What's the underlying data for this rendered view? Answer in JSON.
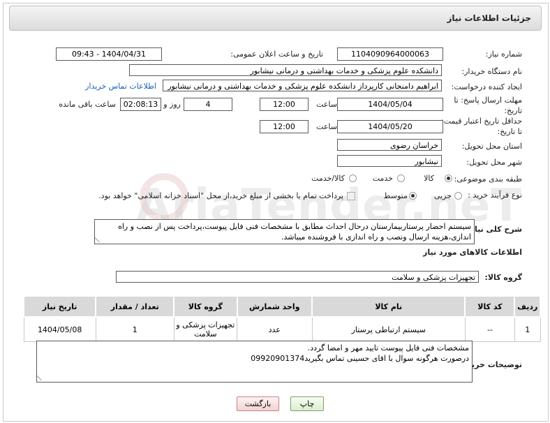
{
  "header": {
    "title": "جزئیات اطلاعات نیاز"
  },
  "form": {
    "need_number_label": "شماره نیاز:",
    "need_number": "1104090964000063",
    "announce_label": "تاریخ و ساعت اعلان عمومی:",
    "announce_value": "1404/04/31 - 09:43",
    "buyer_org_label": "نام دستگاه خریدار:",
    "buyer_org": "دانشکده علوم پزشکی و خدمات بهداشتی و درمانی نیشابور",
    "creator_label": "ایجاد کننده درخواست:",
    "creator": "ابراهیم دامنجانی  کارپرداز دانشکده علوم پزشکی و خدمات بهداشتی و درمانی نیشابور",
    "contact_link": "اطلاعات تماس خریدار",
    "deadline_label": "مهلت ارسال پاسخ: تا تاریخ:",
    "deadline_date": "1404/05/04",
    "time_label": "ساعت",
    "deadline_time": "12:00",
    "days_value": "4",
    "days_label": "روز و",
    "remaining_time": "02:08:13",
    "remaining_label": "ساعت باقی مانده",
    "price_valid_label": "حداقل تاریخ اعتبار قیمت: تا تاریخ:",
    "price_valid_date": "1404/05/20",
    "price_valid_time": "12:00",
    "province_label": "استان محل تحویل:",
    "province": "خراسان رضوی",
    "city_label": "شهر محل تحویل:",
    "city": "نیشابور",
    "category_label": "طبقه بندی موضوعی:",
    "category_options": [
      "کالا",
      "خدمت",
      "کالا/خدمت"
    ],
    "category_selected": "کالا",
    "process_label": "نوع فرآیند خرید :",
    "process_options": [
      "جزیی",
      "متوسط"
    ],
    "process_selected": "متوسط",
    "payment_note": "پرداخت تمام یا بخشی از مبلغ خرید،از محل \"اسناد خزانه اسلامی\" خواهد بود."
  },
  "description": {
    "label": "شرح کلی نیاز:",
    "text": "سیستم احضار پرستاربیمارستان درحال احداث مطابق با مشخصات فنی فایل پیوست،پرداخت پس از نصب و راه اندازی،هزینه ارسال ونصب و راه اندازی با فروشنده میباشد."
  },
  "goods": {
    "section_title": "اطلاعات کالاهای مورد نیاز",
    "group_label": "گروه کالا:",
    "group_value": "تجهیزات پزشکی و سلامت",
    "columns": [
      "ردیف",
      "کد کالا",
      "نام کالا",
      "واحد شمارش",
      "گروه کالا",
      "تعداد / مقدار",
      "تاریخ نیاز"
    ],
    "rows": [
      [
        "1",
        "--",
        "سیستم ارتباطی پرستار",
        "عدد",
        "تجهیزات پزشکی و سلامت",
        "1",
        "1404/05/08"
      ]
    ]
  },
  "buyer_notes": {
    "label": "توضیحات خریدار:",
    "line1": "مشخصات فنی فایل پیوست تایید مهر و امضا گردد.",
    "line2": "درصورت هرگونه سوال با اقای حسینی تماس بگیرید09920901374"
  },
  "buttons": {
    "print": "چاپ",
    "back": "بازگشت"
  },
  "watermark": "AriaTender.neT"
}
